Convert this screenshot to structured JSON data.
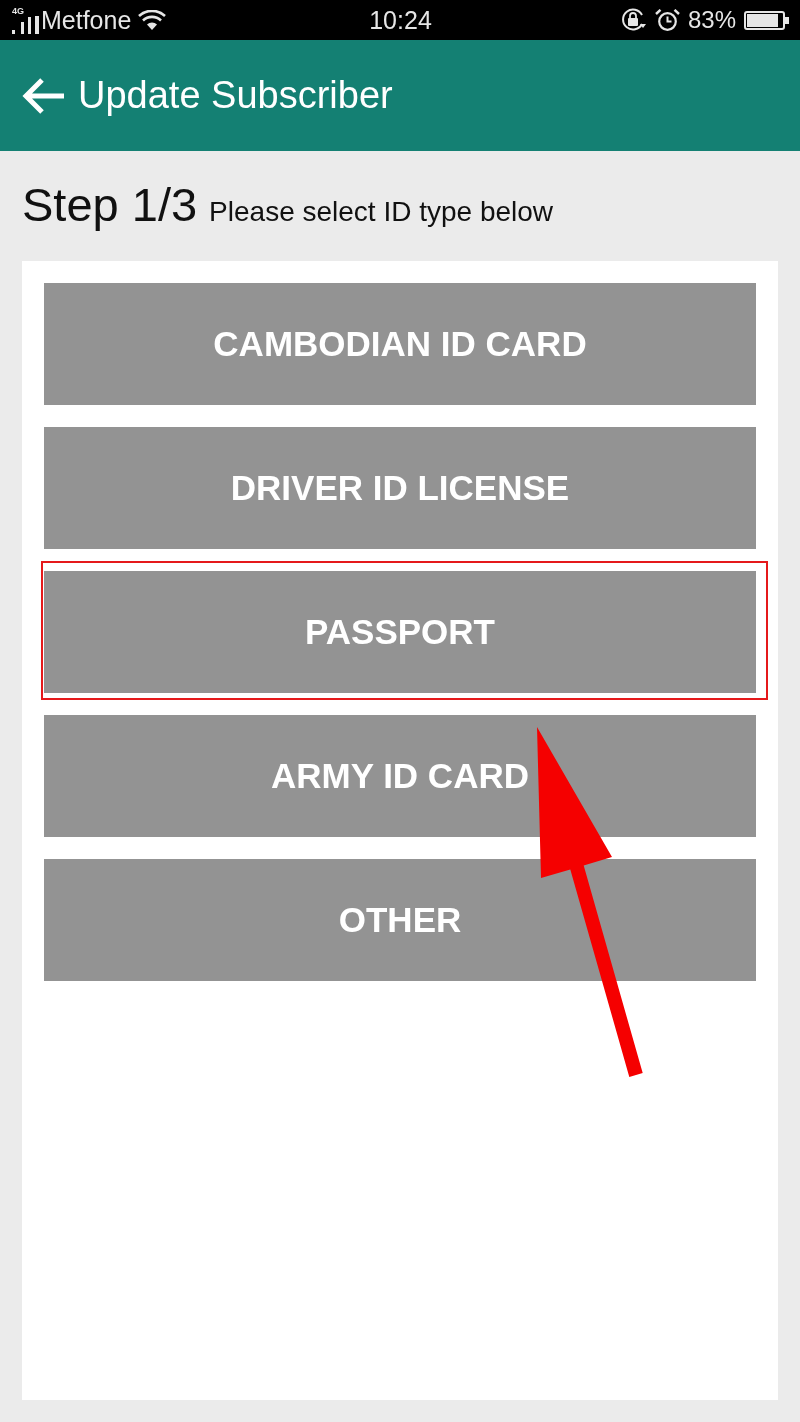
{
  "status_bar": {
    "network_type": "4G",
    "carrier": "Metfone",
    "time": "10:24",
    "battery": "83%"
  },
  "app_bar": {
    "title": "Update Subscriber"
  },
  "step": {
    "label": "Step 1/3",
    "instruction": "Please select ID type below"
  },
  "options": [
    {
      "label": "CAMBODIAN ID CARD",
      "highlighted": false
    },
    {
      "label": "DRIVER ID LICENSE",
      "highlighted": false
    },
    {
      "label": "PASSPORT",
      "highlighted": true
    },
    {
      "label": "ARMY ID CARD",
      "highlighted": false
    },
    {
      "label": "OTHER",
      "highlighted": false
    }
  ]
}
